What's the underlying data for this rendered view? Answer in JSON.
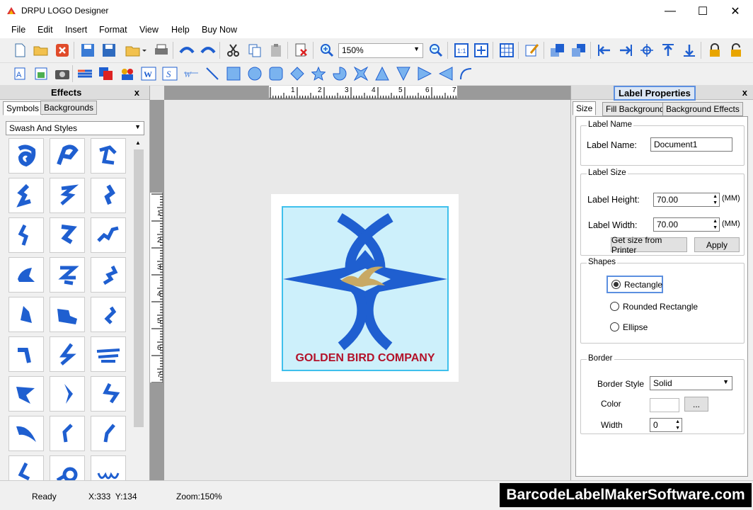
{
  "window": {
    "title": "DRPU LOGO Designer",
    "minimize": "—",
    "maximize": "☐",
    "close": "✕"
  },
  "menu": [
    "File",
    "Edit",
    "Insert",
    "Format",
    "View",
    "Help",
    "Buy Now"
  ],
  "toolbar": {
    "zoom_value": "150%"
  },
  "effects_panel": {
    "title": "Effects",
    "close": "x",
    "tabs": [
      "Symbols",
      "Backgrounds"
    ],
    "category": "Swash And Styles"
  },
  "ruler": {
    "top_ticks": [
      "1",
      "2",
      "3",
      "4",
      "5",
      "6",
      "7"
    ],
    "left_ticks": [
      "1",
      "2",
      "3",
      "4",
      "5",
      "6",
      "7"
    ]
  },
  "canvas": {
    "company_name": "GOLDEN BIRD COMPANY",
    "colors": {
      "blue": "#1f5fd0",
      "gold": "#c8a964",
      "bg": "#cdf0fb",
      "text": "#b3122a"
    }
  },
  "label_properties": {
    "title": "Label Properties",
    "close": "x",
    "tabs": [
      "Size",
      "Fill Background",
      "Background Effects"
    ],
    "label_name_group": "Label Name",
    "label_name_caption": "Label Name:",
    "label_name_value": "Document1",
    "label_size_group": "Label Size",
    "height_caption": "Label Height:",
    "height_value": "70.00",
    "width_caption": "Label Width:",
    "width_value": "70.00",
    "unit": "(MM)",
    "get_size_button": "Get size from Printer",
    "apply_button": "Apply",
    "shapes_group": "Shapes",
    "shape_rect": "Rectangle",
    "shape_rounded": "Rounded Rectangle",
    "shape_ellipse": "Ellipse",
    "border_group": "Border",
    "border_style_caption": "Border Style",
    "border_style_value": "Solid",
    "color_caption": "Color",
    "color_button": "...",
    "width_caption2": "Width",
    "width_border_value": "0"
  },
  "status": {
    "ready": "Ready",
    "coords": "X:333  Y:134",
    "zoom": "Zoom:150%"
  },
  "watermark": "BarcodeLabelMakerSoftware.com"
}
